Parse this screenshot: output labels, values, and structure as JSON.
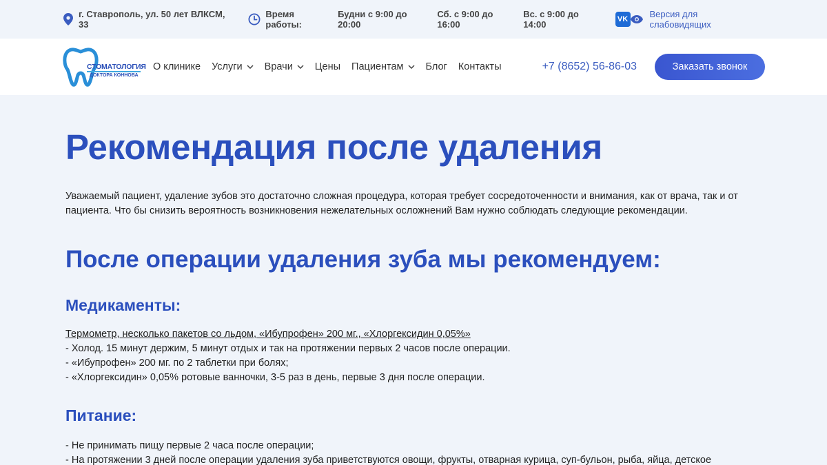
{
  "topbar": {
    "address": "г. Ставрополь, ул. 50 лет ВЛКСМ, 33",
    "hours_label": "Время работы:",
    "weekdays": "Будни с 9:00 до 20:00",
    "saturday": "Сб. с 9:00 до 16:00",
    "sunday": "Вс. с 9:00 до 14:00",
    "vk_label": "VK",
    "accessibility": "Версия для слабовидящих"
  },
  "logo": {
    "line1": "СТОМАТОЛОГИЯ",
    "line2": "ДОКТОРА КОННОВА"
  },
  "nav": {
    "items": [
      {
        "label": "О клинике",
        "dropdown": false
      },
      {
        "label": "Услуги",
        "dropdown": true
      },
      {
        "label": "Врачи",
        "dropdown": true
      },
      {
        "label": "Цены",
        "dropdown": false
      },
      {
        "label": "Пациентам",
        "dropdown": true
      },
      {
        "label": "Блог",
        "dropdown": false
      },
      {
        "label": "Контакты",
        "dropdown": false
      }
    ],
    "phone": "+7 (8652) 56-86-03",
    "cta": "Заказать звонок"
  },
  "page": {
    "title": "Рекомендация после удаления",
    "intro_line1": "Уважаемый пациент, удаление зубов это достаточно сложная процедура, которая требует сосредоточенности и внимания, как от врача, так и от",
    "intro_line2": "пациента. Что бы снизить вероятность возникновения нежелательных осложнений Вам нужно соблюдать следующие рекомендации.",
    "subtitle": "После операции удаления зуба мы рекомендуем:",
    "section1": {
      "heading": "Медикаменты:",
      "underlined": "Термометр, несколько пакетов со льдом, «Ибупрофен» 200 мг., «Хлоргексидин 0,05%»",
      "lines": [
        "- Холод. 15 минут держим, 5 минут отдых и так на протяжении первых 2 часов после операции.",
        "- «Ибупрофен» 200 мг. по 2 таблетки при болях;",
        "- «Хлоргексидин» 0,05% ротовые ванночки, 3-5 раз в день, первые 3 дня после операции."
      ]
    },
    "section2": {
      "heading": "Питание:",
      "lines": [
        "- Не принимать пищу первые 2 часа после операции;",
        "- На протяжении 3 дней после операции удаления зуба приветствуются овощи, фрукты, отварная курица, суп-бульон, рыба, яйца, детское"
      ]
    }
  }
}
